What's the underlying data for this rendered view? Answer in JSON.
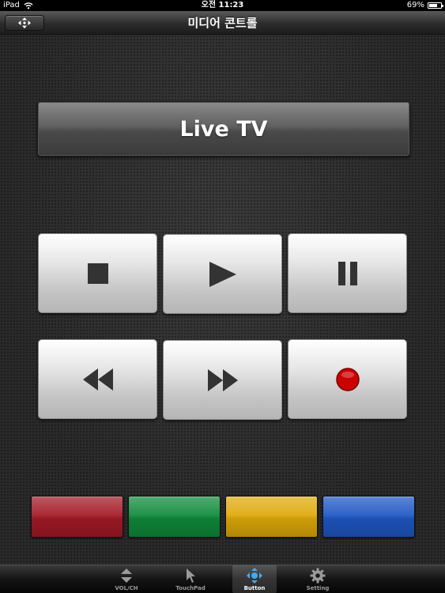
{
  "status_bar": {
    "device": "iPad",
    "time": "오전 11:23",
    "battery": "69%"
  },
  "nav": {
    "title": "미디어 콘트롤",
    "back_icon": "move-arrows-icon"
  },
  "main": {
    "live_tv_label": "Live TV",
    "media_buttons": [
      {
        "name": "stop",
        "icon": "stop-icon"
      },
      {
        "name": "play",
        "icon": "play-icon"
      },
      {
        "name": "pause",
        "icon": "pause-icon"
      },
      {
        "name": "rewind",
        "icon": "rewind-icon"
      },
      {
        "name": "fast-forward",
        "icon": "fast-forward-icon"
      },
      {
        "name": "record",
        "icon": "record-icon"
      }
    ],
    "color_buttons": [
      {
        "name": "red",
        "color": "#a31a26"
      },
      {
        "name": "green",
        "color": "#0f8a3a"
      },
      {
        "name": "yellow",
        "color": "#dfa90a"
      },
      {
        "name": "blue",
        "color": "#1f57c4"
      }
    ]
  },
  "tabs": [
    {
      "label": "VOL/CH",
      "icon": "vol-ch-icon",
      "selected": false
    },
    {
      "label": "TouchPad",
      "icon": "pointer-icon",
      "selected": false
    },
    {
      "label": "Button",
      "icon": "dpad-icon",
      "selected": true
    },
    {
      "label": "Setting",
      "icon": "gear-icon",
      "selected": false
    }
  ],
  "colors": {
    "record_red": "#cc0000",
    "icon_dark": "#333333",
    "tab_active_icon": "#4aa8e8"
  }
}
